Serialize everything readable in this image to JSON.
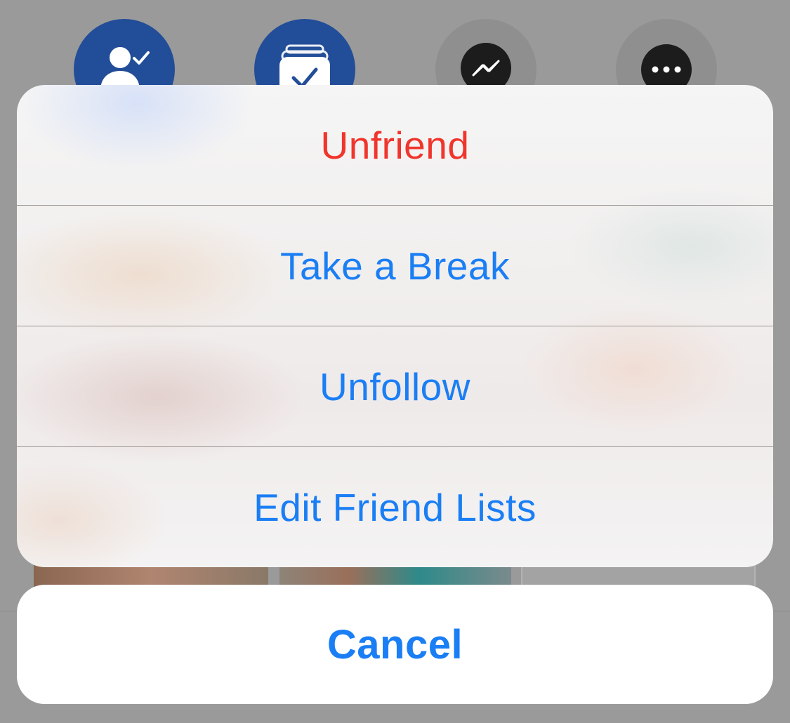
{
  "background": {
    "action_buttons": [
      {
        "icon": "friend-check-icon",
        "color": "#224d98"
      },
      {
        "icon": "friend-list-check-icon",
        "color": "#224d98"
      },
      {
        "icon": "messenger-icon",
        "color": "#8f8f8f"
      },
      {
        "icon": "more-dots-icon",
        "color": "#8f8f8f"
      }
    ]
  },
  "action_sheet": {
    "items": [
      {
        "label": "Unfriend",
        "style": "destructive",
        "color": "#f0352c"
      },
      {
        "label": "Take a Break",
        "style": "default",
        "color": "#1a7ef5"
      },
      {
        "label": "Unfollow",
        "style": "default",
        "color": "#1a7ef5"
      },
      {
        "label": "Edit Friend Lists",
        "style": "default",
        "color": "#1a7ef5"
      }
    ],
    "cancel_label": "Cancel"
  }
}
